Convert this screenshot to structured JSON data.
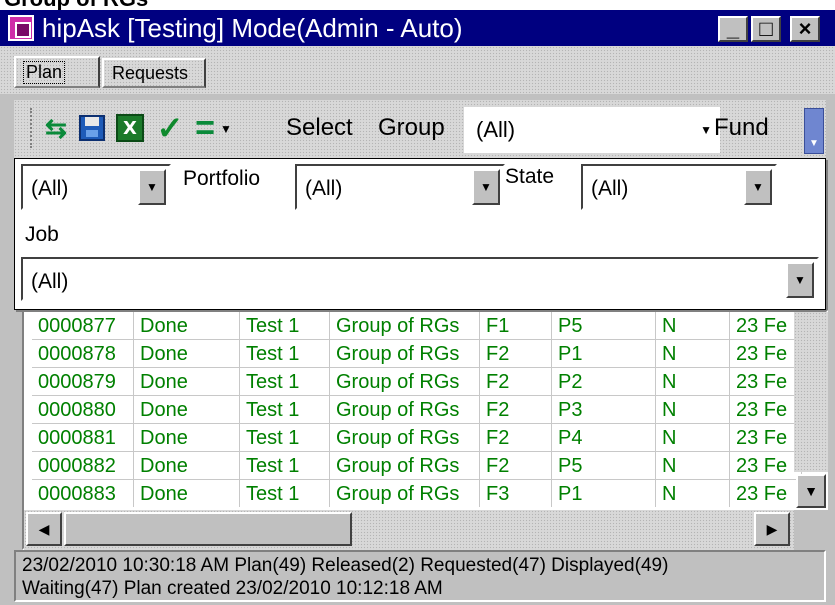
{
  "banner": {
    "text": "Group of RGs"
  },
  "window": {
    "title": "hipAsk [Testing] Mode(Admin - Auto)",
    "minimize": "_",
    "maximize": "□",
    "close": "×"
  },
  "tabs": [
    {
      "label": "Plan",
      "active": true
    },
    {
      "label": "Requests",
      "active": false
    }
  ],
  "toolbar": {
    "icons": [
      "refresh-icon",
      "save-icon",
      "excel-export-icon",
      "checkmark-icon",
      "equals-icon"
    ],
    "select_label": "Select",
    "group_label": "Group",
    "group_value": "(All)",
    "fund_label": "Fund"
  },
  "filters": {
    "fund_value": "(All)",
    "portfolio_label": "Portfolio",
    "portfolio_value": "(All)",
    "state_label": "State",
    "state_value": "(All)",
    "job_label": "Job",
    "job_value": "(All)"
  },
  "grid": {
    "rows": [
      [
        "0000877",
        "Done",
        "Test 1",
        "Group of RGs",
        "F1",
        "P5",
        "N",
        "23 Fe"
      ],
      [
        "0000878",
        "Done",
        "Test 1",
        "Group of RGs",
        "F2",
        "P1",
        "N",
        "23 Fe"
      ],
      [
        "0000879",
        "Done",
        "Test 1",
        "Group of RGs",
        "F2",
        "P2",
        "N",
        "23 Fe"
      ],
      [
        "0000880",
        "Done",
        "Test 1",
        "Group of RGs",
        "F2",
        "P3",
        "N",
        "23 Fe"
      ],
      [
        "0000881",
        "Done",
        "Test 1",
        "Group of RGs",
        "F2",
        "P4",
        "N",
        "23 Fe"
      ],
      [
        "0000882",
        "Done",
        "Test 1",
        "Group of RGs",
        "F2",
        "P5",
        "N",
        "23 Fe"
      ],
      [
        "0000883",
        "Done",
        "Test 1",
        "Group of RGs",
        "F3",
        "P1",
        "N",
        "23 Fe"
      ]
    ],
    "text_color": "#008000"
  },
  "status": {
    "line1": "23/02/2010 10:30:18 AM  Plan(49)  Released(2)  Requested(47)  Displayed(49)",
    "line2": "Waiting(47) Plan created 23/02/2010 10:12:18 AM"
  },
  "colors": {
    "titlebar": "#000080",
    "face": "#c0c0c0"
  }
}
